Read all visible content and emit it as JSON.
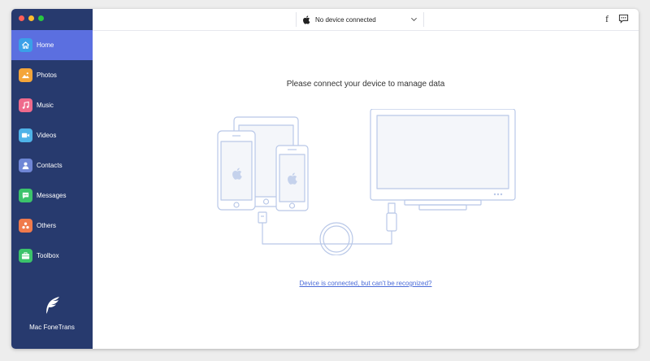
{
  "app": {
    "name": "Mac FoneTrans",
    "colors": {
      "sidebar": "#273a6e",
      "active": "#5b6fe0",
      "link": "#4a6bd8",
      "outline": "#b9c8e8"
    }
  },
  "window_controls": [
    "close",
    "minimize",
    "zoom"
  ],
  "sidebar": {
    "items": [
      {
        "label": "Home",
        "icon": "home-icon",
        "color": "#3aa0e8",
        "active": true
      },
      {
        "label": "Photos",
        "icon": "photos-icon",
        "color": "#f4a53a"
      },
      {
        "label": "Music",
        "icon": "music-icon",
        "color": "#ef6a8c"
      },
      {
        "label": "Videos",
        "icon": "videos-icon",
        "color": "#4fb3e8"
      },
      {
        "label": "Contacts",
        "icon": "contacts-icon",
        "color": "#6f86d6"
      },
      {
        "label": "Messages",
        "icon": "messages-icon",
        "color": "#3cc36b"
      },
      {
        "label": "Others",
        "icon": "others-icon",
        "color": "#f07a4c"
      },
      {
        "label": "Toolbox",
        "icon": "toolbox-icon",
        "color": "#3cc36b"
      }
    ]
  },
  "topbar": {
    "device_label": "No device connected",
    "icons": [
      "facebook-icon",
      "feedback-icon"
    ]
  },
  "main": {
    "headline": "Please connect your device to manage data",
    "help_link": "Device is connected, but can't be recognized?"
  }
}
